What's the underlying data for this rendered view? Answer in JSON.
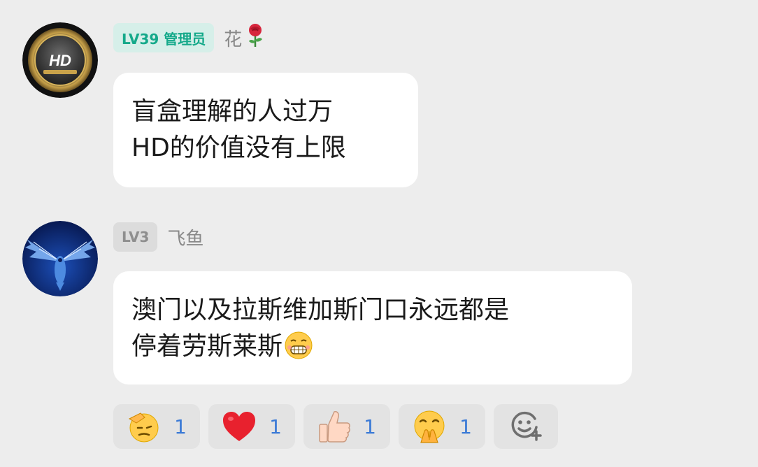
{
  "messages": [
    {
      "level": "LV39 管理员",
      "nickname": "花",
      "nickname_emoji": "rose-icon",
      "avatar": "hd-badge-avatar",
      "avatar_text": "HD",
      "lines": [
        "盲盒理解的人过万",
        "HD的价值没有上限"
      ]
    },
    {
      "level": "LV3",
      "nickname": "飞鱼",
      "avatar": "flying-fish-avatar",
      "lines": [
        "澳门以及拉斯维加斯门口永远都是",
        "停着劳斯莱斯"
      ],
      "trailing_emoji": "grimace-icon"
    }
  ],
  "reactions": [
    {
      "icon": "salute-face-icon",
      "count": "1"
    },
    {
      "icon": "heart-icon",
      "count": "1"
    },
    {
      "icon": "thumbs-up-icon",
      "count": "1"
    },
    {
      "icon": "hand-over-mouth-icon",
      "count": "1"
    }
  ],
  "add_reaction_icon": "add-reaction-icon",
  "colors": {
    "background": "#ededed",
    "bubble": "#ffffff",
    "admin_badge_bg": "#d6efe9",
    "admin_badge_text": "#14a98a",
    "reaction_count": "#3b7ad6"
  }
}
